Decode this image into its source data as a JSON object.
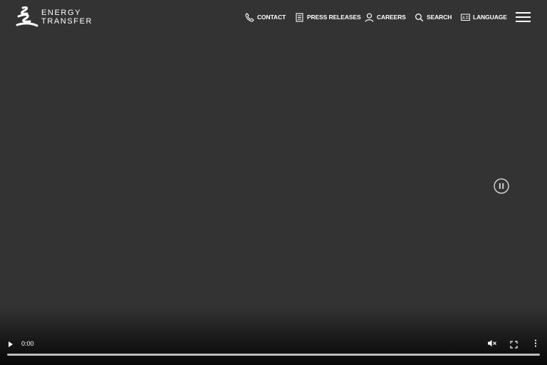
{
  "brand": {
    "line1": "ENERGY",
    "line2": "TRANSFER"
  },
  "nav": {
    "contact": "CONTACT",
    "press_releases": "PRESS RELEASES",
    "careers": "CAREERS",
    "search": "SEARCH",
    "language": "LANGUAGE"
  },
  "video": {
    "current_time": "0:00",
    "progress": 0
  },
  "colors": {
    "background": "#333333",
    "foreground": "#ffffff",
    "progress_track": "#bdbdbd"
  },
  "icons": [
    "logo-icon",
    "phone-icon",
    "newspaper-icon",
    "user-icon",
    "search-icon",
    "language-icon",
    "hamburger-menu-icon",
    "pause-icon",
    "play-icon",
    "mute-icon",
    "fullscreen-icon",
    "more-vertical-icon"
  ]
}
